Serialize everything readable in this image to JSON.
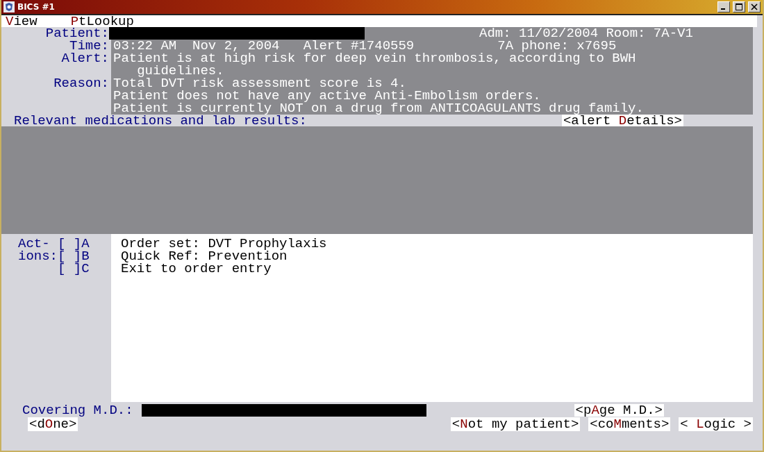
{
  "window": {
    "title": "BICS #1"
  },
  "menu": [
    {
      "key": "V",
      "after": "iew"
    },
    {
      "key": "P",
      "after": "tLookup"
    }
  ],
  "header": {
    "patient_label": "Patient:",
    "admission": "Adm: 11/02/2004 Room: 7A-V1",
    "time_label": "Time:",
    "time": "03:22 AM  Nov 2, 2004   Alert #1740559",
    "phone": "7A phone: x7695",
    "alert_label": "Alert:",
    "alert": "Patient is at high risk for deep vein thrombosis, according to BWH guidelines.",
    "reason_label": "Reason:",
    "reasons": [
      "Total DVT risk assessment score is 4.",
      "Patient does not have any active Anti-Embolism orders.",
      "Patient is currently NOT on a drug from ANTICOAGULANTS drug family."
    ]
  },
  "relevant": {
    "label": "Relevant medications and lab results:",
    "details_button": {
      "before": "<alert ",
      "key": "D",
      "after": "etails>"
    }
  },
  "actions": {
    "label": [
      "Act-",
      "ions:"
    ],
    "items": [
      {
        "checkbox": "[ ]A",
        "text": "Order set: DVT Prophylaxis",
        "checked": false
      },
      {
        "checkbox": "[ ]B",
        "text": "Quick Ref: Prevention",
        "checked": false
      },
      {
        "checkbox": "[ ]C",
        "text": "Exit to order entry",
        "checked": false
      }
    ]
  },
  "covering": {
    "label": "Covering M.D.:",
    "page_button": {
      "before": "<p",
      "key": "A",
      "after": "ge M.D.>"
    }
  },
  "buttons": [
    {
      "kind": "left",
      "before": "<d",
      "key": "O",
      "after": "ne>"
    },
    {
      "kind": "right",
      "before": "<",
      "key": "N",
      "after": "ot my patient>"
    },
    {
      "kind": "right",
      "before": "<co",
      "key": "M",
      "after": "ments>"
    },
    {
      "kind": "right",
      "before": "< ",
      "key": "L",
      "after": "ogic >"
    }
  ]
}
